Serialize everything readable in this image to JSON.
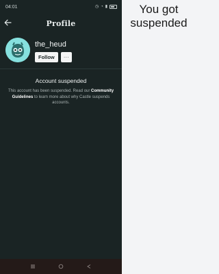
{
  "status_bar": {
    "time": "04:01"
  },
  "header": {
    "title": "Profile"
  },
  "profile": {
    "username": "the_heud",
    "follow_label": "Follow",
    "more_label": "···"
  },
  "suspended": {
    "title": "Account suspended",
    "body_before": "This account has been suspended. Read our ",
    "link": "Community Guidelines",
    "body_after": " to learn more about why Castle suspends accounts."
  },
  "caption": {
    "line1": "You got",
    "line2": "suspended"
  },
  "colors": {
    "background": "#1a2424",
    "navbar": "#241a18",
    "avatar": "#86e0de"
  },
  "icons": [
    "back-arrow-icon",
    "wifi-icon",
    "signal-icon",
    "battery-icon",
    "menu-icon",
    "home-icon",
    "back-icon"
  ]
}
